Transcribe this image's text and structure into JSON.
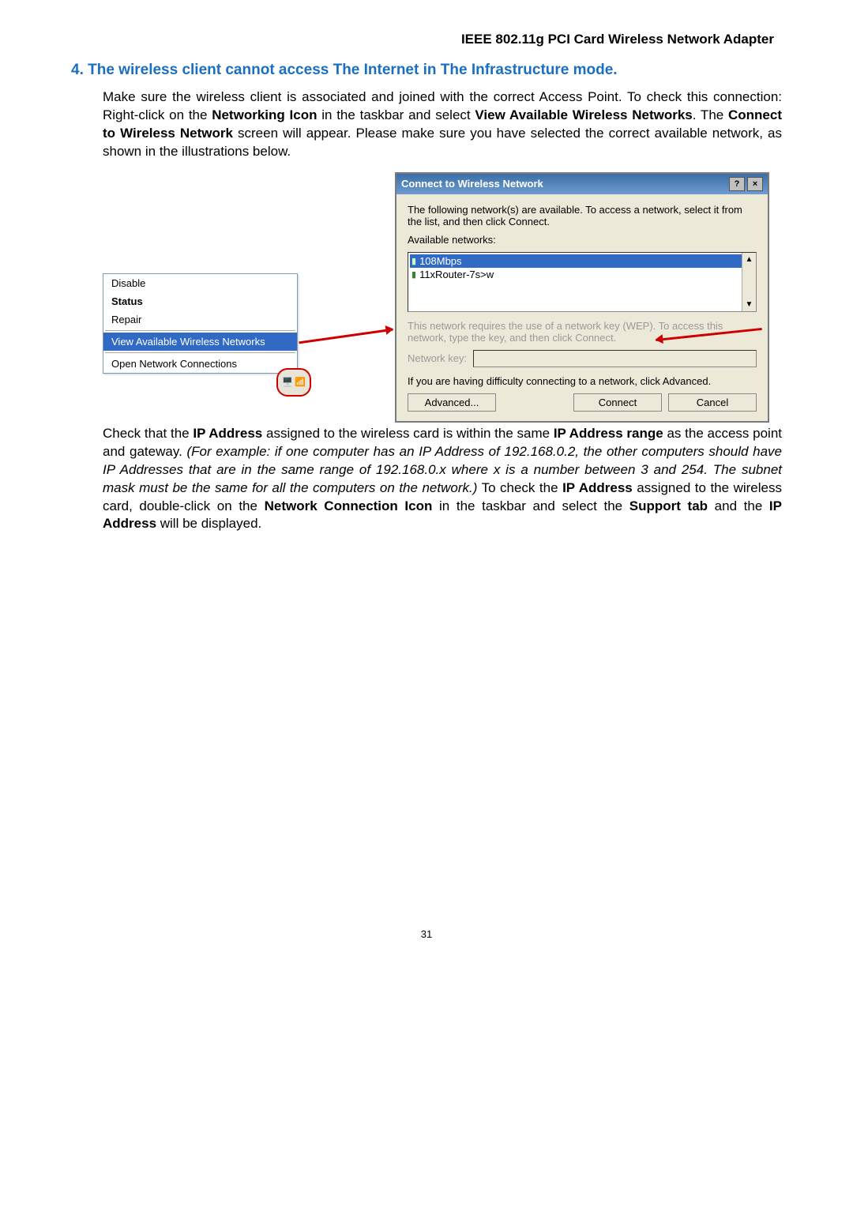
{
  "header": {
    "title": "IEEE 802.11g PCI Card Wireless Network Adapter"
  },
  "section": {
    "heading": "4.  The wireless client cannot access The Internet in The Infrastructure mode."
  },
  "para1": {
    "pre": "Make sure the wireless client is associated and joined with the correct Access Point. To check this connection: Right-click on the ",
    "b1": "Networking Icon",
    "mid1": " in the taskbar and select ",
    "b2": "View Available Wireless Networks",
    "mid2": ". The ",
    "b3": "Connect to Wireless Network",
    "post": " screen will appear. Please make sure you have selected the correct available network, as shown in the illustrations below."
  },
  "ctx": {
    "disable": "Disable",
    "status": "Status",
    "repair": "Repair",
    "view": "View Available Wireless Networks",
    "open": "Open Network Connections"
  },
  "dialog": {
    "title": "Connect to Wireless Network",
    "help_btn": "?",
    "close_btn": "×",
    "desc": "The following network(s) are available. To access a network, select it from the list, and then click Connect.",
    "avail_label": "Available networks:",
    "net1": "108Mbps",
    "net2": "11xRouter-7s>w",
    "wep_text": "This network requires the use of a network key (WEP). To access this network, type the key, and then click Connect.",
    "netkey_label": "Network key:",
    "adv_text": "If you are having difficulty connecting to a network, click Advanced.",
    "btn_adv": "Advanced...",
    "btn_connect": "Connect",
    "btn_cancel": "Cancel"
  },
  "para2": {
    "pre": "Check that the ",
    "b1": "IP Address",
    "mid1": " assigned to the wireless card is within the same ",
    "b2": "IP Address range",
    "mid2": " as the access point and gateway. ",
    "italic": "(For example: if one computer has an IP Address of 192.168.0.2, the other computers should have IP Addresses that are in the same range of 192.168.0.x where x is a number between 3 and 254. The subnet mask must be the same for all the computers on the network.)",
    "mid3": " To check the ",
    "b3": "IP Address",
    "mid4": " assigned to the wireless card, double-click on the ",
    "b4": "Network Connection Icon",
    "mid5": " in the taskbar and select the ",
    "b5": "Support tab",
    "mid6": " and the ",
    "b6": "IP Address",
    "post": " will be displayed."
  },
  "page_number": "31"
}
